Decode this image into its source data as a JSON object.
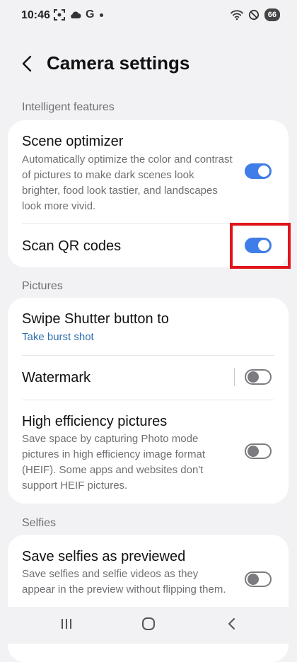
{
  "status_bar": {
    "time": "10:46",
    "g_label": "G",
    "battery": "66",
    "icons_left": [
      "screenshot-icon",
      "cloud-icon",
      "google-icon",
      "notification-dot-icon"
    ],
    "icons_right": [
      "wifi-icon",
      "do-not-disturb-icon",
      "battery-icon"
    ]
  },
  "header": {
    "title": "Camera settings"
  },
  "sections": {
    "intelligent": "Intelligent features",
    "pictures": "Pictures",
    "selfies": "Selfies"
  },
  "items": {
    "scene_optimizer": {
      "title": "Scene optimizer",
      "desc": "Automatically optimize the color and contrast of pictures to make dark scenes look brighter, food look tastier, and landscapes look more vivid.",
      "enabled": true
    },
    "scan_qr": {
      "title": "Scan QR codes",
      "enabled": true
    },
    "swipe_shutter": {
      "title": "Swipe Shutter button to",
      "value": "Take burst shot"
    },
    "watermark": {
      "title": "Watermark",
      "enabled": false
    },
    "high_efficiency": {
      "title": "High efficiency pictures",
      "desc": "Save space by capturing Photo mode pictures in high efficiency image format (HEIF). Some apps and websites don't support HEIF pictures.",
      "enabled": false
    },
    "save_selfies": {
      "title": "Save selfies as previewed",
      "desc": "Save selfies and selfie videos as they appear in the preview without flipping them.",
      "enabled": false
    }
  },
  "colors": {
    "accent": "#3f7ee8",
    "highlight": "#e0141b",
    "link": "#2f6fae"
  }
}
